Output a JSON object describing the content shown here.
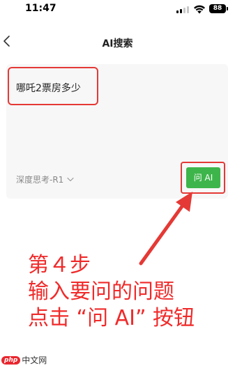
{
  "status_bar": {
    "time": "11:47",
    "battery": "88",
    "icons": [
      "signal-icon",
      "wifi-icon",
      "battery-icon"
    ]
  },
  "nav": {
    "title": "AI搜索",
    "back_icon": "chevron-left-icon"
  },
  "search": {
    "query": "哪吒2票房多少",
    "model_label": "深度思考-R1",
    "ask_button_label": "问 AI",
    "ask_button_color": "#3db54a"
  },
  "annotation": {
    "step": "第４步",
    "line2": "输入要问的问题",
    "line3": "点击 “问 AI” 按钮",
    "color": "#f02a2a"
  },
  "watermark": {
    "badge": "php",
    "text": "中文网"
  }
}
